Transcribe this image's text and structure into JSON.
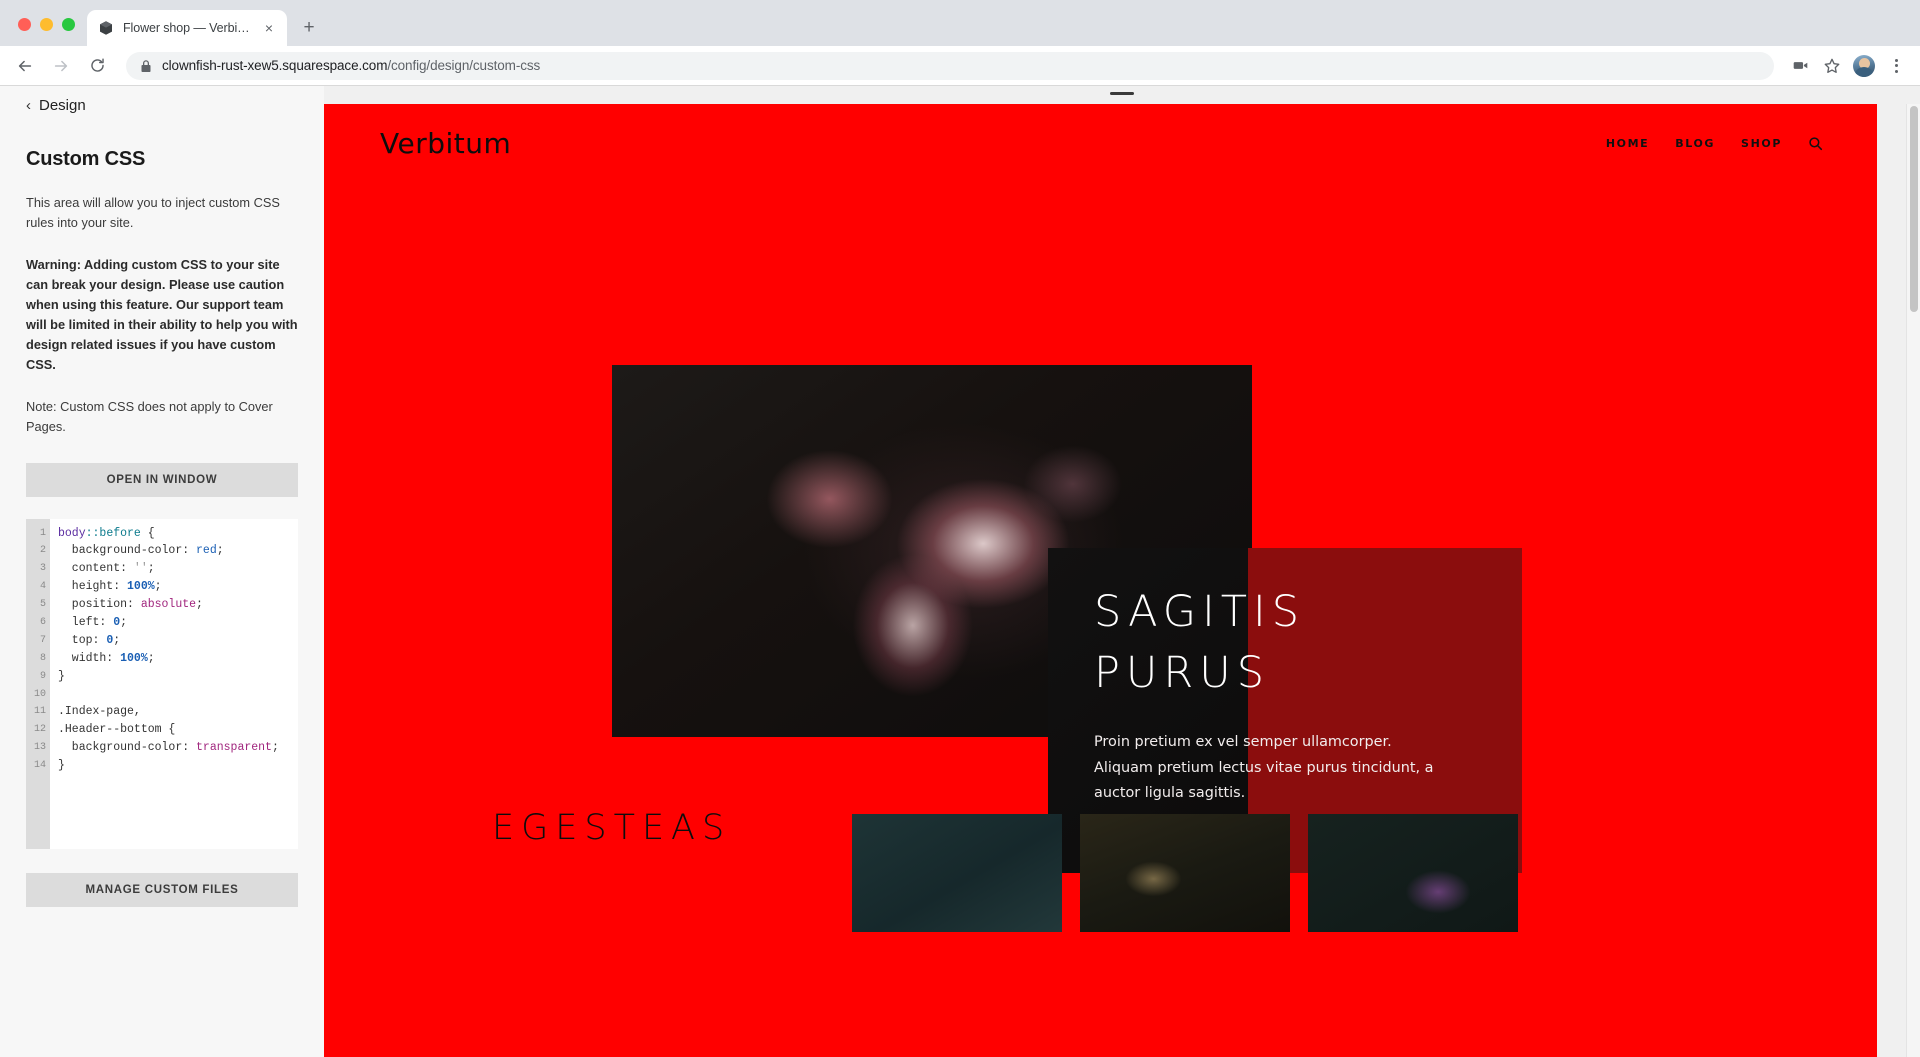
{
  "browser": {
    "tab": {
      "title": "Flower shop — Verbitum",
      "favicon": "cube-icon",
      "close": "×"
    },
    "new_tab_label": "+",
    "omnibox": {
      "url_secure_prefix": "clownfish-rust-xew5.squarespace.com",
      "url_path": "/config/design/custom-css",
      "full_url": "clownfish-rust-xew5.squarespace.com/config/design/custom-css",
      "lock": "lock-icon"
    },
    "toolbar_icons": [
      "back-arrow-icon",
      "forward-arrow-icon",
      "reload-icon",
      "video-camera-icon",
      "bookmark-star-icon",
      "profile-avatar",
      "kebab-menu-icon"
    ]
  },
  "panel": {
    "back_label": "Design",
    "back_chevron": "‹",
    "title": "Custom CSS",
    "paragraphs": [
      "This area will allow you to inject custom CSS rules into your site.",
      "Warning: Adding custom CSS to your site can break your design. Please use caution when using this feature. Our support team will be limited in their ability to help you with design related issues if you have custom CSS.",
      "Note: Custom CSS does not apply to Cover Pages."
    ],
    "open_in_window_label": "OPEN IN WINDOW",
    "manage_files_label": "MANAGE CUSTOM FILES"
  },
  "editor": {
    "line_numbers": [
      "1",
      "2",
      "3",
      "4",
      "5",
      "6",
      "7",
      "8",
      "9",
      "10",
      "11",
      "12",
      "13",
      "14"
    ],
    "lines": [
      "body::before {",
      "  background-color: red;",
      "  content: '';",
      "  height: 100%;",
      "  position: absolute;",
      "  left: 0;",
      "  top: 0;",
      "  width: 100%;",
      "}",
      "",
      ".Index-page,",
      ".Header--bottom {",
      "  background-color: transparent;",
      "}"
    ]
  },
  "site": {
    "background_color": "#ff0000",
    "logo": "Verbitum",
    "nav": [
      {
        "label": "HOME"
      },
      {
        "label": "BLOG"
      },
      {
        "label": "SHOP"
      }
    ],
    "search_icon": "search-icon",
    "hero": {
      "heading_line1": "SAGITIS",
      "heading_line2": "PURUS",
      "paragraph": "Proin pretium ex vel semper ullamcorper. Aliquam pretium lectus vitae purus tincidunt, a auctor ligula sagittis.",
      "overlay_color": "#8b0d0d"
    },
    "lower": {
      "section_title": "EGESTEAS",
      "thumbnails": [
        "teal-dark-photo",
        "foliage-dark-photo",
        "purple-bokeh-photo"
      ]
    }
  }
}
